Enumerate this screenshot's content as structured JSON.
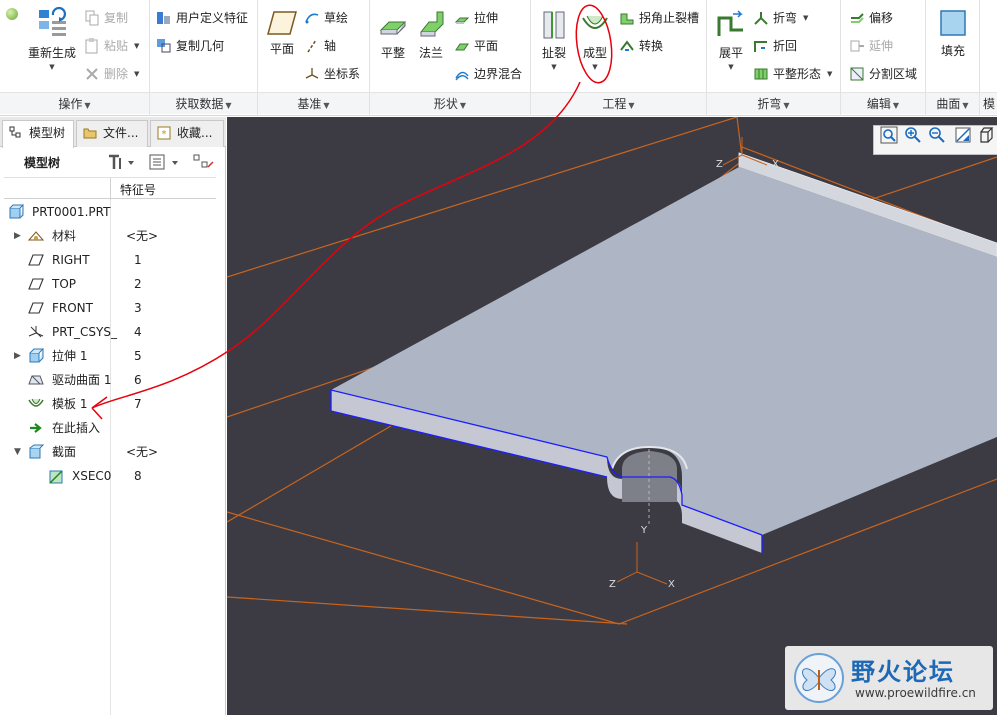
{
  "ribbon": {
    "regenerate": {
      "label": "重新生成"
    },
    "copy": "复制",
    "paste": "粘贴",
    "delete": "删除",
    "user_feature": "用户定义特征",
    "copy_geometry": "复制几何",
    "plane": "平面",
    "sketch": "草绘",
    "axis": "轴",
    "csys": "坐标系",
    "flat": "平整",
    "flange": "法兰",
    "extrude": "拉伸",
    "plane2": "平面",
    "boundary_blend": "边界混合",
    "rip": "扯裂",
    "form": "成型",
    "corner_relief": "拐角止裂槽",
    "convert": "转换",
    "unbend": "展平",
    "bend": "折弯",
    "bend_back": "折回",
    "flat_pattern": "平整形态",
    "offset": "偏移",
    "extend": "延伸",
    "split_region": "分割区域",
    "fill": "填充",
    "groups": {
      "operations": "操作",
      "get_data": "获取数据",
      "datum": "基准",
      "shapes": "形状",
      "engineering": "工程",
      "bends": "折弯",
      "editing": "编辑",
      "surfaces": "曲面",
      "partial": "模"
    }
  },
  "panel": {
    "tabs": [
      "模型树",
      "文件...",
      "收藏..."
    ],
    "tree_title": "模型树",
    "column_header": "特征号",
    "rows": [
      {
        "label": "PRT0001.PRT",
        "id": "",
        "icon": "part-icon",
        "expand": ""
      },
      {
        "label": "材料",
        "id": "<无>",
        "icon": "material-icon",
        "expand": "▶"
      },
      {
        "label": "RIGHT",
        "id": "1",
        "icon": "datum-plane-icon",
        "expand": ""
      },
      {
        "label": "TOP",
        "id": "2",
        "icon": "datum-plane-icon",
        "expand": ""
      },
      {
        "label": "FRONT",
        "id": "3",
        "icon": "datum-plane-icon",
        "expand": ""
      },
      {
        "label": "PRT_CSYS_",
        "id": "4",
        "icon": "csys-icon",
        "expand": ""
      },
      {
        "label": "拉伸 1",
        "id": "5",
        "icon": "extrude-icon",
        "expand": "▶"
      },
      {
        "label": "驱动曲面 1",
        "id": "6",
        "icon": "driving-surface-icon",
        "expand": ""
      },
      {
        "label": "模板 1",
        "id": "7",
        "icon": "form-icon",
        "expand": ""
      },
      {
        "label": "在此插入",
        "id": "",
        "icon": "insert-here-icon",
        "expand": ""
      },
      {
        "label": "截面",
        "id": "<无>",
        "icon": "section-icon",
        "expand": "▼"
      },
      {
        "label": "XSEC0",
        "id": "8",
        "icon": "xsection-icon",
        "expand": ""
      }
    ]
  },
  "viewport": {
    "axis_labels": {
      "x": "X",
      "y": "Y",
      "z": "Z"
    }
  },
  "watermark": {
    "title": "野火论坛",
    "url": "www.proewildfire.cn"
  },
  "colors": {
    "viewport_bg": "#3c3b43",
    "part_top": "#aeb6c5",
    "part_edge": "#1d1dff",
    "datum_orange": "#c8641e",
    "annotation_red": "#e8000b",
    "watermark_blue": "#1d69b5"
  }
}
